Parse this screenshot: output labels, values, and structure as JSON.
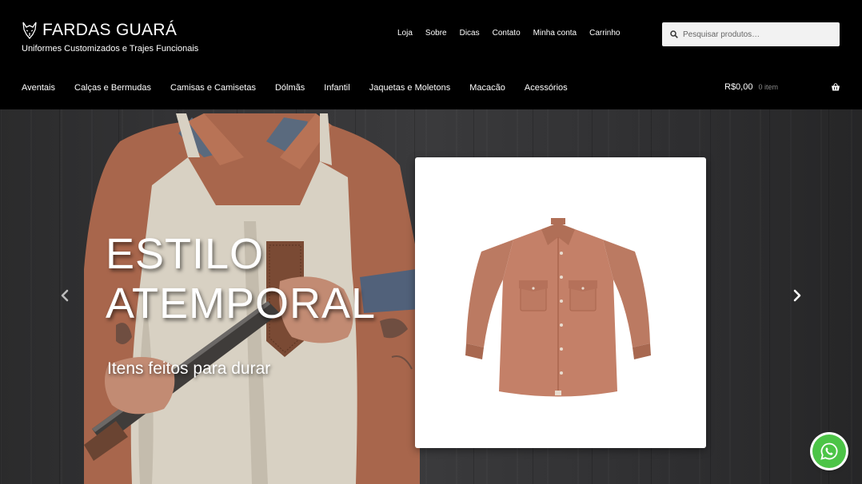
{
  "brand": {
    "name": "FARDAS GUARÁ",
    "tagline": "Uniformes Customizados e Trajes Funcionais"
  },
  "top_nav": [
    "Loja",
    "Sobre",
    "Dicas",
    "Contato",
    "Minha conta",
    "Carrinho"
  ],
  "search": {
    "placeholder": "Pesquisar produtos…"
  },
  "categories": [
    "Aventais",
    "Calças e Bermudas",
    "Camisas e Camisetas",
    "Dólmãs",
    "Infantil",
    "Jaquetas e Moletons",
    "Macacão",
    "Acessórios"
  ],
  "cart": {
    "total": "R$0,00",
    "count": "0 item"
  },
  "hero": {
    "title_line1": "ESTILO",
    "title_line2": "ATEMPORAL",
    "subtitle": "Itens feitos para durar"
  },
  "icons": {
    "search": "search-icon",
    "cart": "basket-icon",
    "prev": "chevron-left-icon",
    "next": "chevron-right-icon",
    "whatsapp": "whatsapp-icon"
  },
  "colors": {
    "header_bg": "#000000",
    "shirt": "#c07d65",
    "whatsapp": "#4cc447"
  }
}
